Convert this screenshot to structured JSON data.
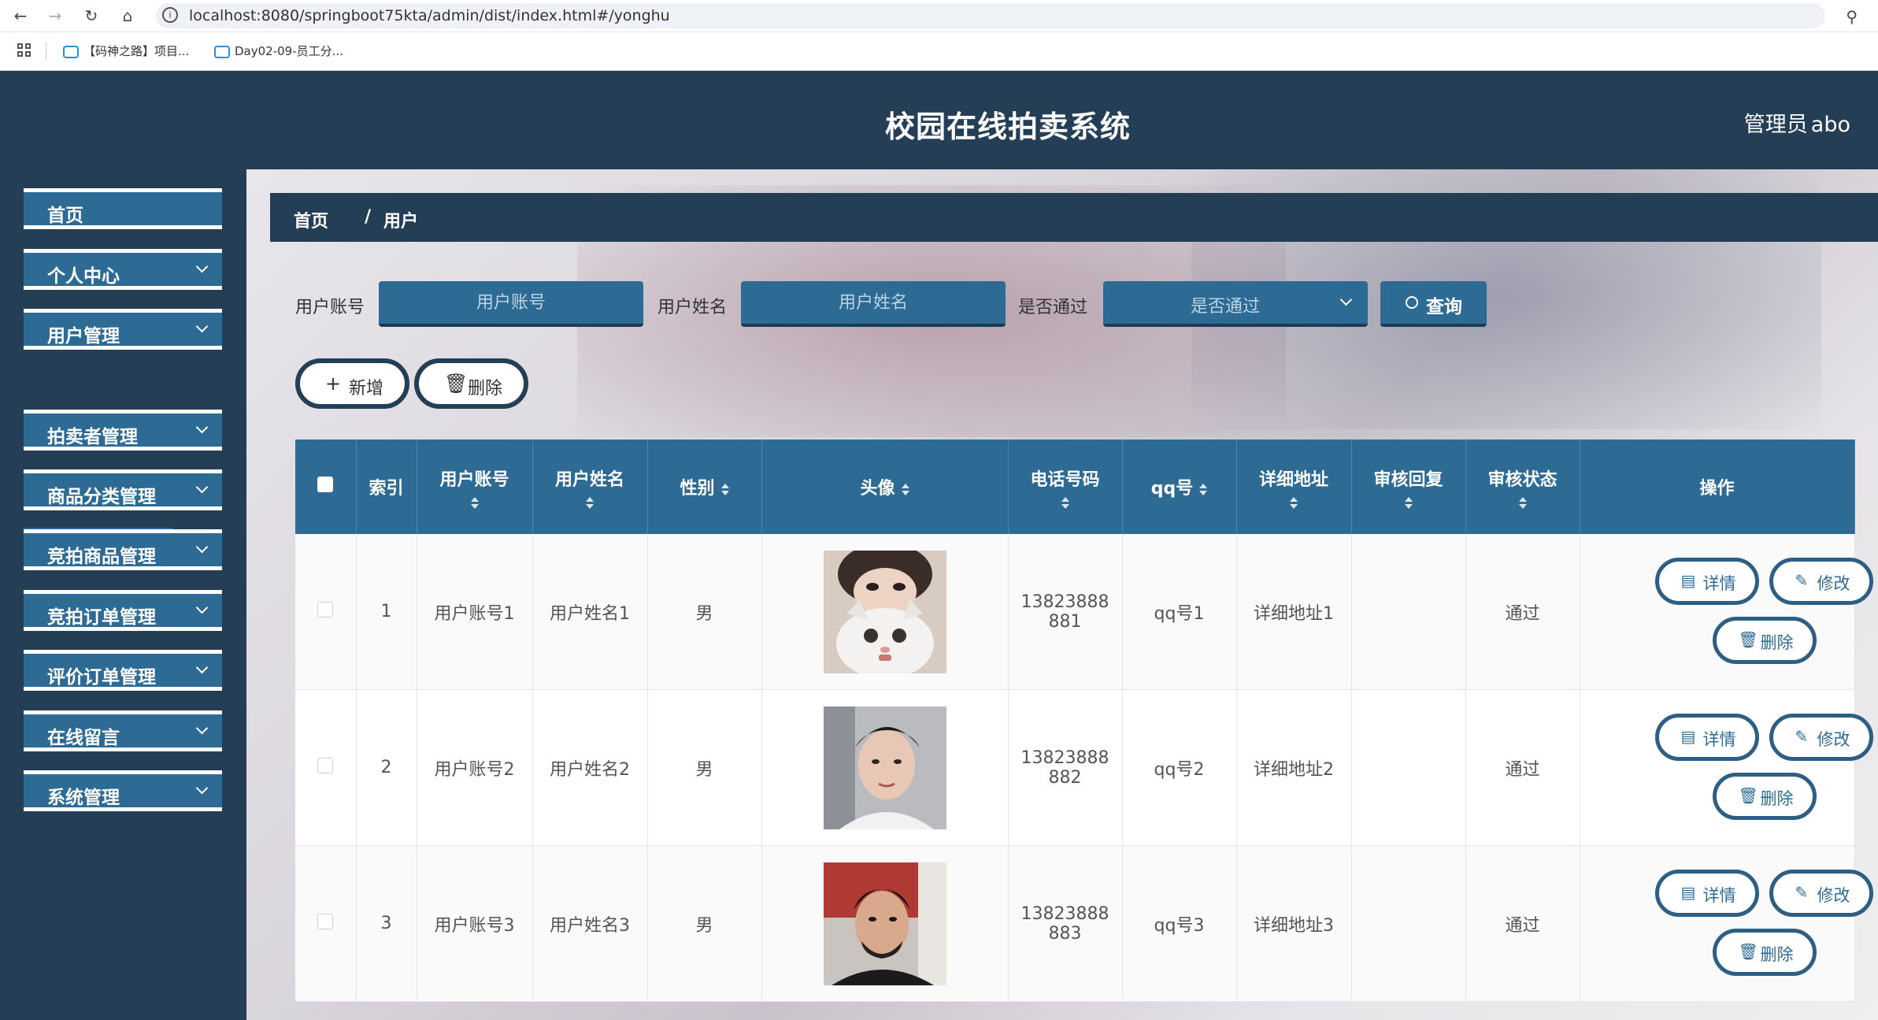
{
  "browser": {
    "url": "localhost:8080/springboot75kta/admin/dist/index.html#/yonghu",
    "bookmarks": [
      "【码神之路】项目...",
      "Day02-09-员工分..."
    ]
  },
  "header": {
    "title": "校园在线拍卖系统",
    "user_role": "管理员",
    "user_name": "abo"
  },
  "sidebar": {
    "items": [
      {
        "label": "首页",
        "expandable": false
      },
      {
        "label": "个人中心",
        "expandable": true
      },
      {
        "label": "用户管理",
        "expandable": true
      },
      {
        "label": "拍卖者管理",
        "expandable": true
      },
      {
        "label": "商品分类管理",
        "expandable": true
      },
      {
        "label": "竞拍商品管理",
        "expandable": true
      },
      {
        "label": "竞拍订单管理",
        "expandable": true
      },
      {
        "label": "评价订单管理",
        "expandable": true
      },
      {
        "label": "在线留言",
        "expandable": true
      },
      {
        "label": "系统管理",
        "expandable": true
      }
    ],
    "active_sub_item": "用户"
  },
  "breadcrumb": {
    "home": "首页",
    "separator": "/",
    "current": "用户"
  },
  "search": {
    "account_label": "用户账号",
    "account_placeholder": "用户账号",
    "name_label": "用户姓名",
    "name_placeholder": "用户姓名",
    "approved_label": "是否通过",
    "approved_placeholder": "是否通过",
    "query_label": "查询"
  },
  "actions": {
    "add_label": "新增",
    "delete_label": "删除"
  },
  "table": {
    "columns": [
      "索引",
      "用户账号",
      "用户姓名",
      "性别",
      "头像",
      "电话号码",
      "qq号",
      "详细地址",
      "审核回复",
      "审核状态",
      "操作"
    ],
    "rows": [
      {
        "index": "1",
        "account": "用户账号1",
        "name": "用户姓名1",
        "gender": "男",
        "phone_a": "13823888",
        "phone_b": "881",
        "qq": "qq号1",
        "address": "详细地址1",
        "reply": "",
        "status": "通过",
        "avatar": "cat-photo"
      },
      {
        "index": "2",
        "account": "用户账号2",
        "name": "用户姓名2",
        "gender": "男",
        "phone_a": "13823888",
        "phone_b": "882",
        "qq": "qq号2",
        "address": "详细地址2",
        "reply": "",
        "status": "通过",
        "avatar": "young-man-photo"
      },
      {
        "index": "3",
        "account": "用户账号3",
        "name": "用户姓名3",
        "gender": "男",
        "phone_a": "13823888",
        "phone_b": "883",
        "qq": "qq号3",
        "address": "详细地址3",
        "reply": "",
        "status": "通过",
        "avatar": "man-portrait-photo"
      }
    ],
    "row_actions": {
      "detail": "详情",
      "edit": "修改",
      "delete": "删除"
    }
  },
  "colors": {
    "header_bg": "#243e56",
    "accent": "#2d6b94",
    "border_dark": "#243e56"
  }
}
